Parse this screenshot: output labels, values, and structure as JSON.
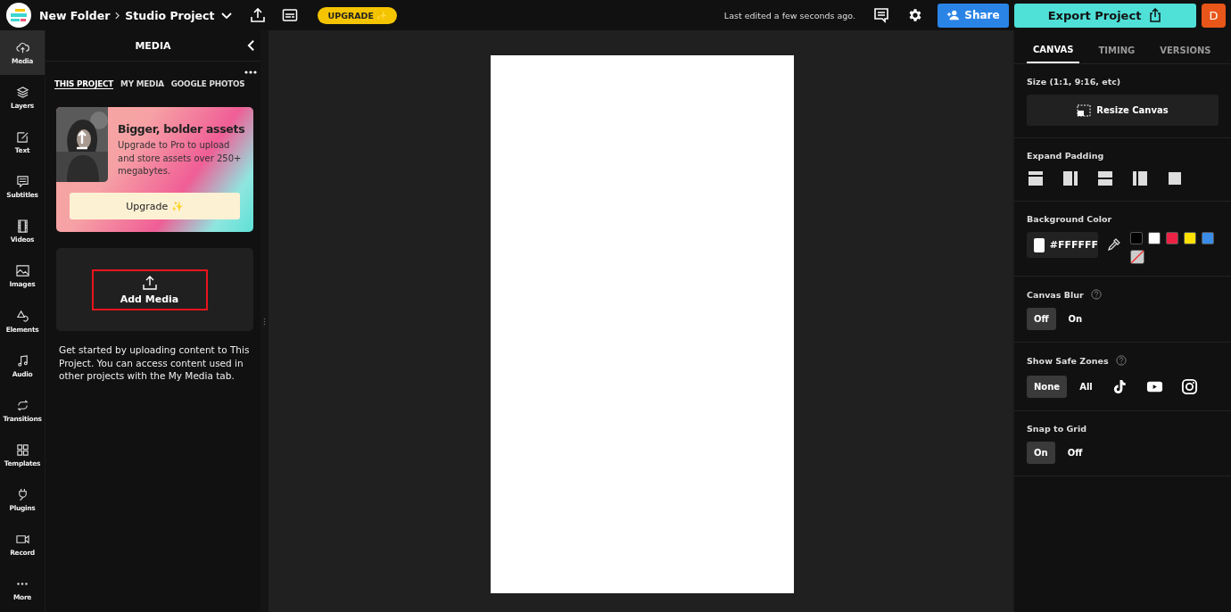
{
  "header": {
    "folder": "New Folder",
    "project": "Studio Project",
    "upgrade_badge": "UPGRADE ✨",
    "last_edited": "Last edited a few seconds ago.",
    "share": "Share",
    "export": "Export Project",
    "avatar": "D"
  },
  "rail": [
    {
      "kind": "media",
      "label": "Media",
      "selected": true
    },
    {
      "kind": "layers",
      "label": "Layers",
      "selected": false
    },
    {
      "kind": "text",
      "label": "Text",
      "selected": false
    },
    {
      "kind": "subtitles",
      "label": "Subtitles",
      "selected": false
    },
    {
      "kind": "videos",
      "label": "Videos",
      "selected": false
    },
    {
      "kind": "images",
      "label": "Images",
      "selected": false
    },
    {
      "kind": "elements",
      "label": "Elements",
      "selected": false
    },
    {
      "kind": "audio",
      "label": "Audio",
      "selected": false
    },
    {
      "kind": "transitions",
      "label": "Transitions",
      "selected": false
    },
    {
      "kind": "templates",
      "label": "Templates",
      "selected": false
    },
    {
      "kind": "plugins",
      "label": "Plugins",
      "selected": false
    },
    {
      "kind": "record",
      "label": "Record",
      "selected": false
    },
    {
      "kind": "more",
      "label": "More",
      "selected": false
    }
  ],
  "media_panel": {
    "title": "MEDIA",
    "tabs": [
      {
        "label": "THIS PROJECT",
        "selected": true
      },
      {
        "label": "MY MEDIA",
        "selected": false
      },
      {
        "label": "GOOGLE PHOTOS",
        "selected": false
      }
    ],
    "promo": {
      "title": "Bigger, bolder assets",
      "body": "Upgrade to Pro to upload and store assets over 250+ megabytes.",
      "button": "Upgrade ✨"
    },
    "add_media": "Add Media",
    "help": "Get started by uploading content to This Project. You can access content used in other projects with the My Media tab."
  },
  "settings": {
    "tabs": [
      {
        "label": "CANVAS",
        "selected": true
      },
      {
        "label": "TIMING",
        "selected": false
      },
      {
        "label": "VERSIONS",
        "selected": false
      }
    ],
    "size": {
      "label": "Size (1:1, 9:16, etc)",
      "button": "Resize Canvas"
    },
    "padding": {
      "label": "Expand Padding",
      "options": [
        {
          "kind": "top"
        },
        {
          "kind": "right"
        },
        {
          "kind": "middle"
        },
        {
          "kind": "left"
        },
        {
          "kind": "full"
        }
      ]
    },
    "background": {
      "label": "Background Color",
      "value": "#FFFFFF",
      "swatches": [
        {
          "kind": "color",
          "color": "#000000"
        },
        {
          "kind": "color",
          "color": "#ffffff"
        },
        {
          "kind": "color",
          "color": "#ee2244"
        },
        {
          "kind": "color",
          "color": "#ffe100"
        },
        {
          "kind": "color",
          "color": "#3b8de8"
        },
        {
          "kind": "none"
        }
      ]
    },
    "blur": {
      "label": "Canvas Blur",
      "options": [
        {
          "kind": "text",
          "label": "Off",
          "selected": true
        },
        {
          "kind": "text",
          "label": "On",
          "selected": false
        }
      ]
    },
    "safe_zones": {
      "label": "Show Safe Zones",
      "options": [
        {
          "kind": "text",
          "label": "None",
          "selected": true
        },
        {
          "kind": "text",
          "label": "All",
          "selected": false
        },
        {
          "kind": "tiktok",
          "selected": false
        },
        {
          "kind": "youtube",
          "selected": false
        },
        {
          "kind": "instagram",
          "selected": false
        }
      ]
    },
    "grid": {
      "label": "Snap to Grid",
      "options": [
        {
          "kind": "text",
          "label": "On",
          "selected": true
        },
        {
          "kind": "text",
          "label": "Off",
          "selected": false
        }
      ]
    }
  }
}
